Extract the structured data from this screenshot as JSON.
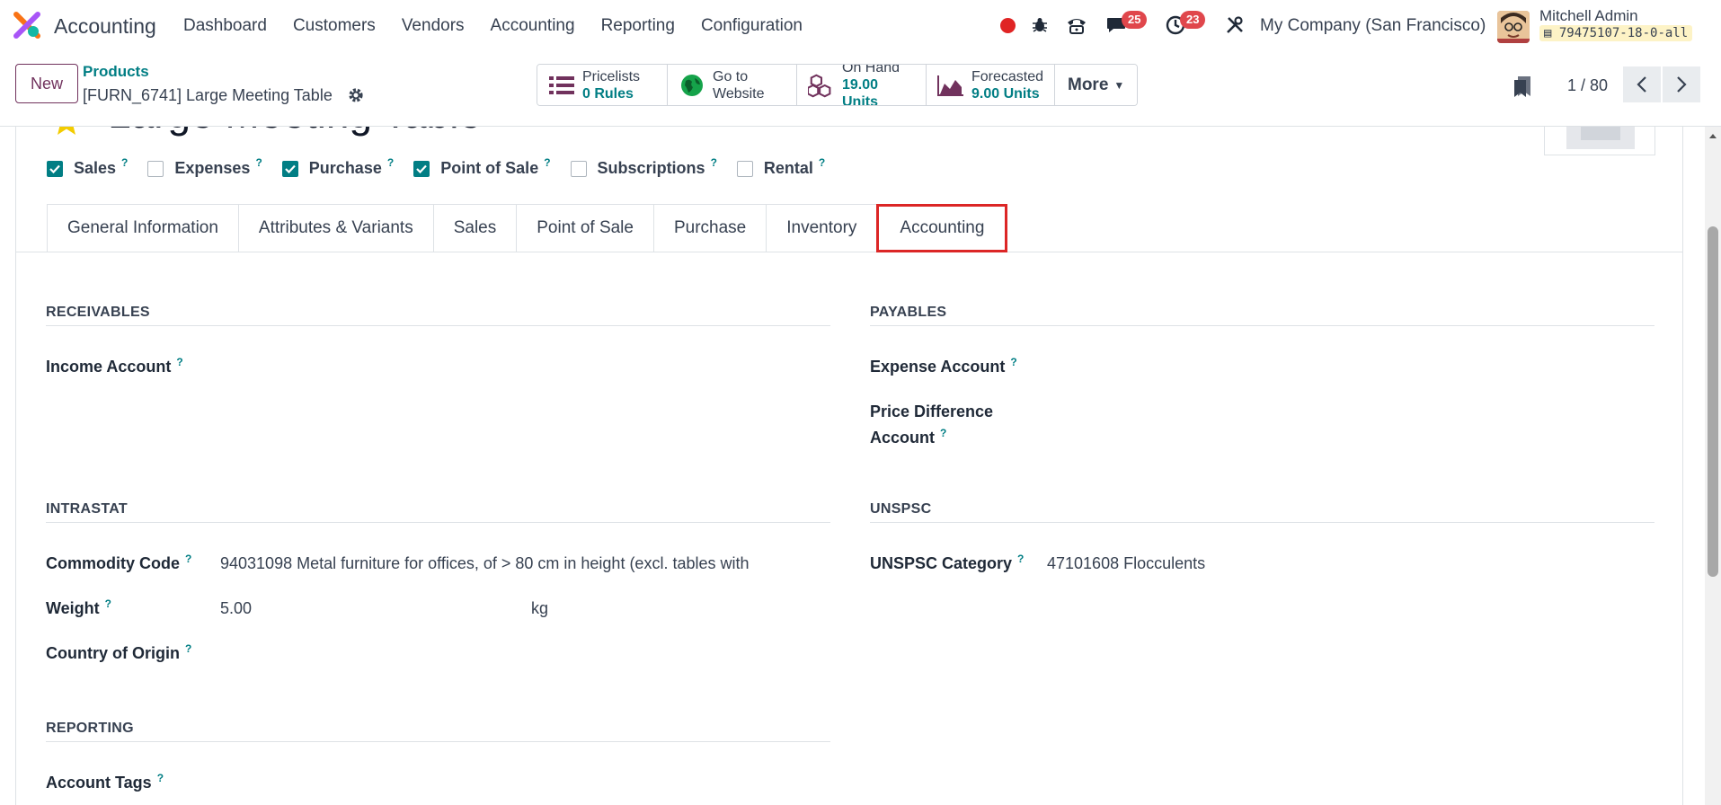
{
  "navbar": {
    "app_name": "Accounting",
    "menu": [
      "Dashboard",
      "Customers",
      "Vendors",
      "Accounting",
      "Reporting",
      "Configuration"
    ],
    "messages_count": "25",
    "activities_count": "23",
    "company": "My Company (San Francisco)",
    "user_name": "Mitchell Admin",
    "database": "79475107-18-0-all"
  },
  "control_panel": {
    "new_label": "New",
    "breadcrumb_parent": "Products",
    "breadcrumb_current": "[FURN_6741] Large Meeting Table",
    "stats": [
      {
        "label": "Pricelists",
        "value": "0 Rules",
        "icon": "list-icon"
      },
      {
        "label": "Go to",
        "value": "Website",
        "icon": "globe-icon"
      },
      {
        "label": "On Hand",
        "value": "19.00 Units",
        "icon": "cubes-icon"
      },
      {
        "label": "Forecasted",
        "value": "9.00 Units",
        "icon": "area-chart-icon"
      }
    ],
    "more_label": "More",
    "pager": "1 / 80"
  },
  "form": {
    "title": "Large Meeting Table",
    "checkboxes": [
      {
        "label": "Sales",
        "checked": true
      },
      {
        "label": "Expenses",
        "checked": false
      },
      {
        "label": "Purchase",
        "checked": true
      },
      {
        "label": "Point of Sale",
        "checked": true
      },
      {
        "label": "Subscriptions",
        "checked": false
      },
      {
        "label": "Rental",
        "checked": false
      }
    ],
    "help_mark": "?",
    "tabs": [
      "General Information",
      "Attributes & Variants",
      "Sales",
      "Point of Sale",
      "Purchase",
      "Inventory",
      "Accounting"
    ],
    "active_tab": "Accounting",
    "receivables": {
      "title": "RECEIVABLES",
      "income_account_label": "Income Account"
    },
    "payables": {
      "title": "PAYABLES",
      "expense_account_label": "Expense Account",
      "price_diff_label_1": "Price Difference",
      "price_diff_label_2": "Account"
    },
    "intrastat": {
      "title": "INTRASTAT",
      "commodity_label": "Commodity Code",
      "commodity_value": "94031098 Metal furniture for offices, of > 80 cm in height (excl. tables with",
      "weight_label": "Weight",
      "weight_value": "5.00",
      "weight_unit": "kg",
      "origin_label": "Country of Origin"
    },
    "unspsc": {
      "title": "UNSPSC",
      "category_label": "UNSPSC Category",
      "category_value": "47101608 Flocculents"
    },
    "reporting": {
      "title": "REPORTING",
      "account_tags_label": "Account Tags"
    }
  },
  "colors": {
    "brand": "#71325d",
    "accent": "#017e84",
    "highlight": "#dc2626",
    "badge": "#e0474c"
  }
}
